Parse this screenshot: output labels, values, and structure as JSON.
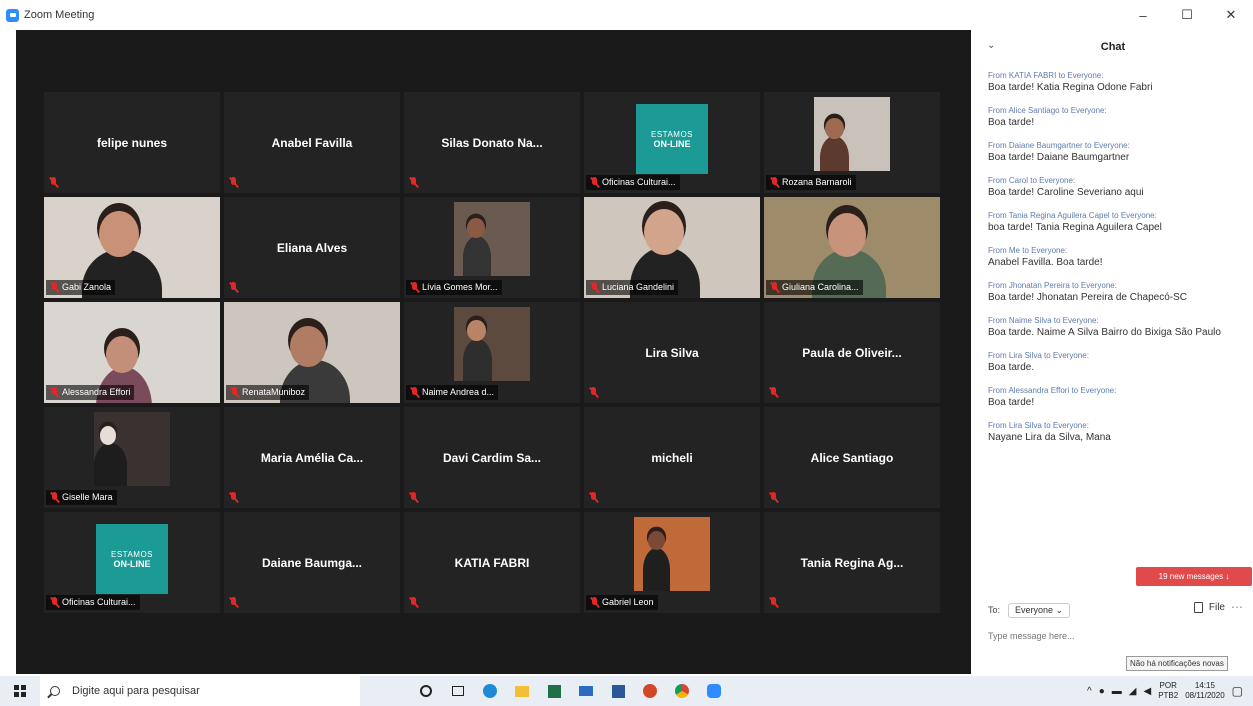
{
  "window": {
    "title": "Zoom Meeting",
    "minimize": "–",
    "maximize": "☐",
    "close": "✕"
  },
  "tiles": [
    {
      "name": "felipe nunes",
      "video": false
    },
    {
      "name": "Anabel Favilla",
      "video": false
    },
    {
      "name": "Silas Donato Na...",
      "video": false
    },
    {
      "name": "Oficinas Culturai...",
      "video": true,
      "kind": "logo"
    },
    {
      "name": "Rozana Barnaroli",
      "video": true
    },
    {
      "name": "Gabi Zanola",
      "video": true
    },
    {
      "name": "Eliana Alves",
      "video": false
    },
    {
      "name": "Lívia Gomes Mor...",
      "video": true
    },
    {
      "name": "Luciana Gandelini",
      "video": true,
      "speaking": true
    },
    {
      "name": "Giuliana Carolina...",
      "video": true
    },
    {
      "name": "Alessandra Effori",
      "video": true
    },
    {
      "name": "RenataMuniboz",
      "video": true
    },
    {
      "name": "Naime Andrea d...",
      "video": true
    },
    {
      "name": "Lira Silva",
      "video": false
    },
    {
      "name": "Paula de Oliveir...",
      "video": false
    },
    {
      "name": "Giselle Mara",
      "video": true
    },
    {
      "name": "Maria Amélia Ca...",
      "video": false
    },
    {
      "name": "Davi Cardim Sa...",
      "video": false
    },
    {
      "name": "micheli",
      "video": false
    },
    {
      "name": "Alice Santiago",
      "video": false
    },
    {
      "name": "Oficinas Culturai...",
      "video": true,
      "kind": "logo"
    },
    {
      "name": "Daiane Baumga...",
      "video": false
    },
    {
      "name": "KATIA FABRI",
      "video": false
    },
    {
      "name": "Gabriel Leon",
      "video": true
    },
    {
      "name": "Tania Regina Ag...",
      "video": false
    }
  ],
  "logo": {
    "line1": "ESTAMOS",
    "line2": "ON-LINE"
  },
  "chat": {
    "title": "Chat",
    "collapse": "⌄",
    "messages": [
      {
        "from": "From KATIA FABRI to Everyone:",
        "text": "Boa tarde! Katia Regina Odone Fabri"
      },
      {
        "from": "From Alice Santiago to Everyone:",
        "text": "Boa tarde!"
      },
      {
        "from": "From Daiane Baumgartner to Everyone:",
        "text": "Boa tarde! Daiane Baumgartner"
      },
      {
        "from": "From Carol to Everyone:",
        "text": "Boa tarde! Caroline Severiano aqui"
      },
      {
        "from": "From Tania Regina Aguilera Capel to Everyone:",
        "text": "boa tarde! Tania Regina Aguilera Capel"
      },
      {
        "from": "From Me to Everyone:",
        "text": "Anabel Favilla. Boa tarde!"
      },
      {
        "from": "From Jhonatan Pereira to Everyone:",
        "text": "Boa tarde! Jhonatan Pereira de Chapecó-SC"
      },
      {
        "from": "From Naime Silva to Everyone:",
        "text": "Boa tarde. Naime A Silva Bairro do Bixiga São Paulo"
      },
      {
        "from": "From Lira Silva to Everyone:",
        "text": "Boa tarde."
      },
      {
        "from": "From Alessandra Effori to Everyone:",
        "text": "Boa tarde!"
      },
      {
        "from": "From Lira Silva to Everyone:",
        "text": "Nayane Lira da Silva, Mana"
      }
    ],
    "new_messages": "19 new messages ↓",
    "to_label": "To:",
    "to_value": "Everyone ⌄",
    "file_label": "File",
    "more": "⋯",
    "input_placeholder": "Type message here..."
  },
  "tooltip": "Não há notificações novas",
  "taskbar": {
    "search_placeholder": "Digite aqui para pesquisar",
    "lang_line1": "POR",
    "lang_line2": "PTB2",
    "time": "14:15",
    "date": "08/11/2020"
  }
}
